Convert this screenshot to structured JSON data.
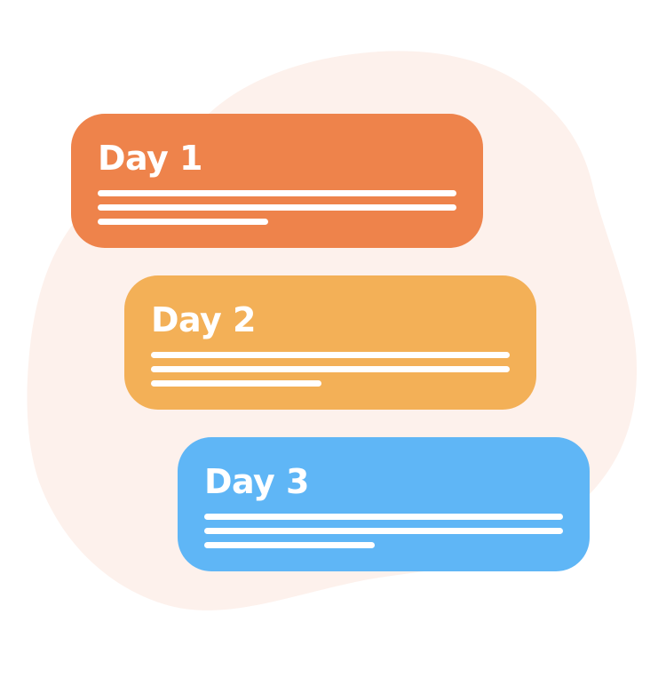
{
  "colors": {
    "background": "#ffffff",
    "blob": "#fdf1ec",
    "text_and_lines": "#ffffff"
  },
  "cards": [
    {
      "title": "Day 1",
      "color": "#ee834b"
    },
    {
      "title": "Day 2",
      "color": "#f3b057"
    },
    {
      "title": "Day 3",
      "color": "#5fb6f6"
    }
  ]
}
